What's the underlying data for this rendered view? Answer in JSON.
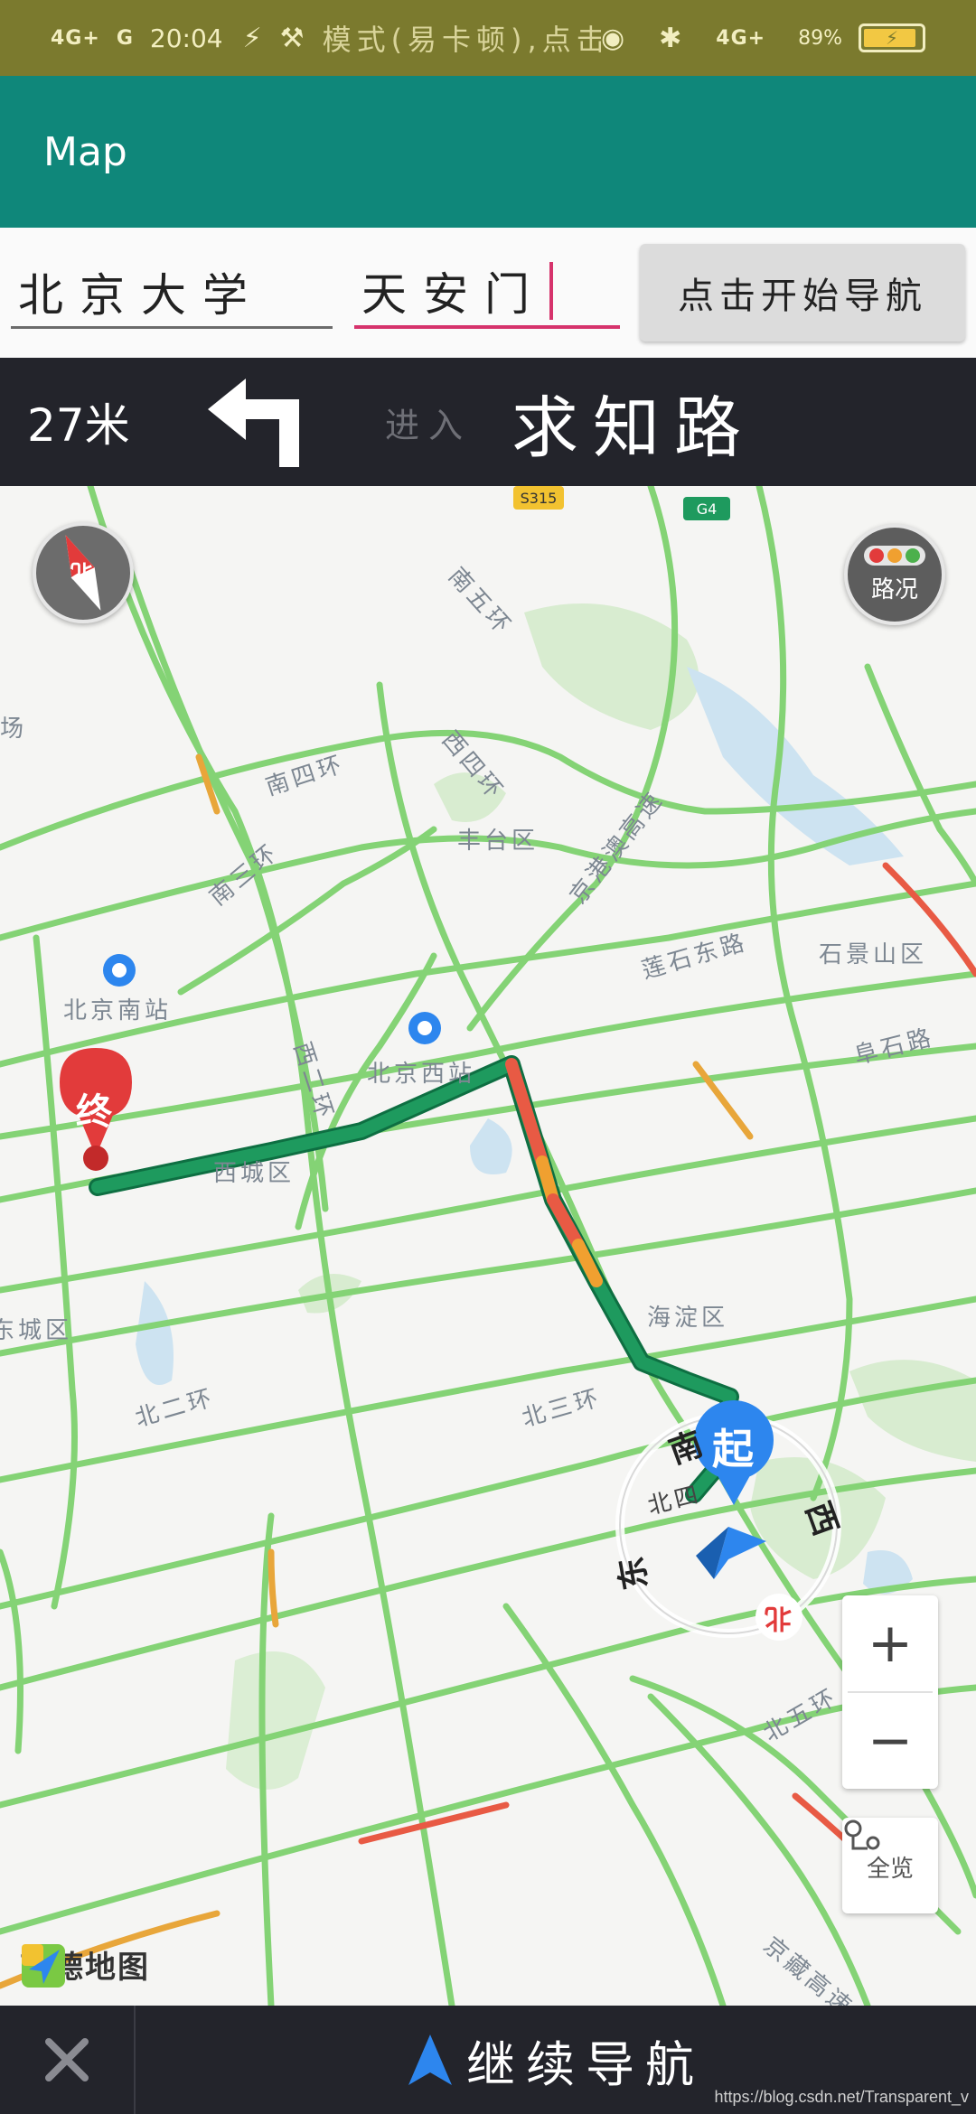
{
  "status_bar": {
    "signal1": "4G+",
    "signal2": "G",
    "time": "20:04",
    "notice": "模式(易卡顿),点击关闭",
    "network_right": "4G+",
    "battery": "89%"
  },
  "app_bar": {
    "title": "Map"
  },
  "inputs": {
    "start_value": "北京大学",
    "end_value": "天安门",
    "nav_button": "点击开始导航"
  },
  "guidance": {
    "distance": "27米",
    "enter": "进入",
    "road": "求知路"
  },
  "map": {
    "labels": [
      "南五环",
      "南四环",
      "南三环",
      "西四环",
      "丰台区",
      "京港澳高速",
      "莲石东路",
      "石景山区",
      "阜石路",
      "北京南站",
      "北京西站",
      "西城区",
      "东城区",
      "海淀区",
      "北二环",
      "北三环",
      "北五环",
      "西二环",
      "京藏高速",
      "场",
      "S315",
      "G4"
    ],
    "start_marker": "起",
    "end_marker": "终",
    "directions": {
      "south": "南",
      "west": "西",
      "east": "东",
      "north": "北"
    },
    "road_bei4": "北四",
    "compass_north": "北",
    "traffic_button": "路况",
    "overview_button": "全览",
    "logo": "高德地图"
  },
  "bottom_bar": {
    "continue": "继续导航",
    "watermark": "https://blog.csdn.net/Transparent_v"
  },
  "colors": {
    "app_bar": "#0f877a",
    "status_bar": "#7b7a2e",
    "route": "#1e9a5e",
    "congestion_red": "#e85a44",
    "congestion_orange": "#f0a030",
    "road_green": "#7bcf6e",
    "accent_pink": "#d6336c",
    "marker_blue": "#2d86ee",
    "marker_red": "#e23b3b"
  }
}
